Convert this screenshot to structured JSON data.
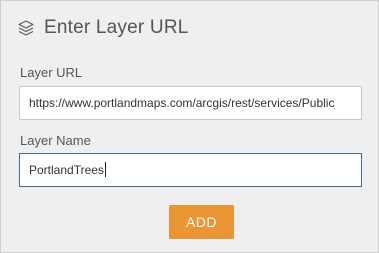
{
  "header": {
    "title": "Enter Layer URL",
    "icon": "layers-icon"
  },
  "form": {
    "url_label": "Layer URL",
    "url_value": "https://www.portlandmaps.com/arcgis/rest/services/Public",
    "name_label": "Layer Name",
    "name_value": "PortlandTrees"
  },
  "actions": {
    "add_label": "ADD"
  },
  "colors": {
    "accent": "#ec9534",
    "focus_border": "#4a6c8f",
    "panel_bg": "#efefef"
  }
}
